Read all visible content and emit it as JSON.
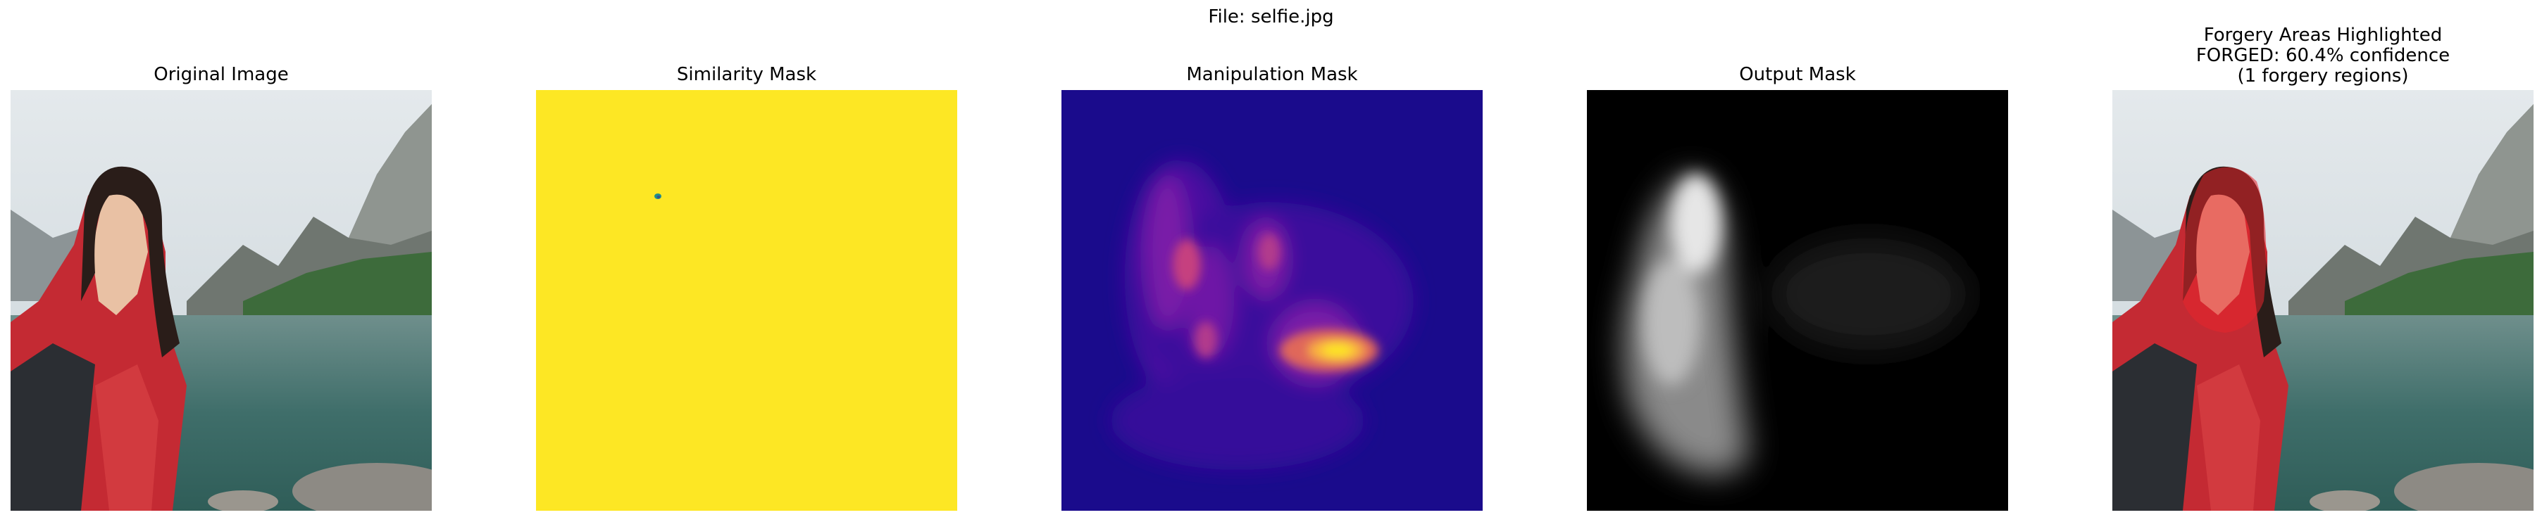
{
  "figure": {
    "suptitle": "File: selfie.jpg"
  },
  "panels": [
    {
      "title": "Original Image"
    },
    {
      "title": "Similarity Mask"
    },
    {
      "title": "Manipulation Mask"
    },
    {
      "title": "Output Mask"
    },
    {
      "title_lines": [
        "Forgery Areas Highlighted",
        "FORGED: 60.4% confidence",
        "(1 forgery regions)"
      ]
    }
  ],
  "colors": {
    "similarity_fill": "#fde724",
    "manipulation_background": "#1a0b8c",
    "output_background": "#000000",
    "forgery_highlight": "#e8242b"
  }
}
